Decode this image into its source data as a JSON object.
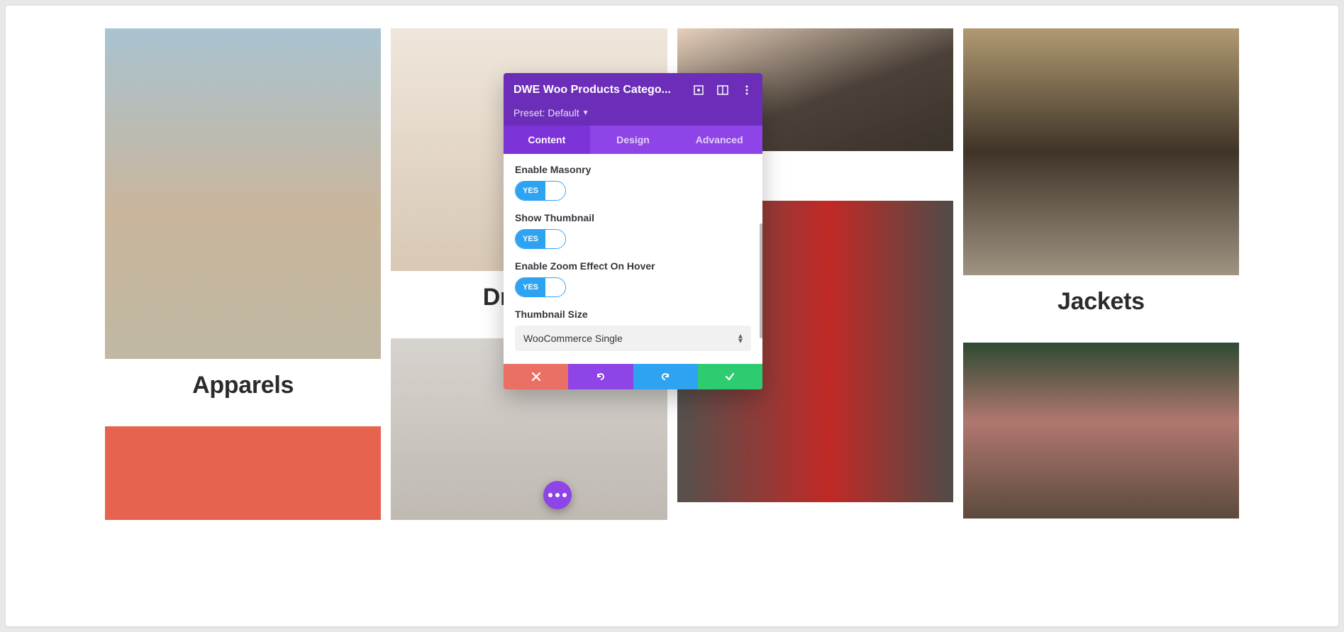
{
  "categories": {
    "apparels": "Apparels",
    "dresses": "Dresses",
    "jackets": "Jackets"
  },
  "modal": {
    "title": "DWE Woo Products Catego...",
    "preset_label": "Preset: Default",
    "tabs": {
      "content": "Content",
      "design": "Design",
      "advanced": "Advanced"
    },
    "fields": {
      "enable_masonry": "Enable Masonry",
      "show_thumbnail": "Show Thumbnail",
      "zoom_hover": "Enable Zoom Effect On Hover",
      "thumbnail_size": "Thumbnail Size"
    },
    "toggle_yes": "YES",
    "select_value": "WooCommerce Single"
  }
}
